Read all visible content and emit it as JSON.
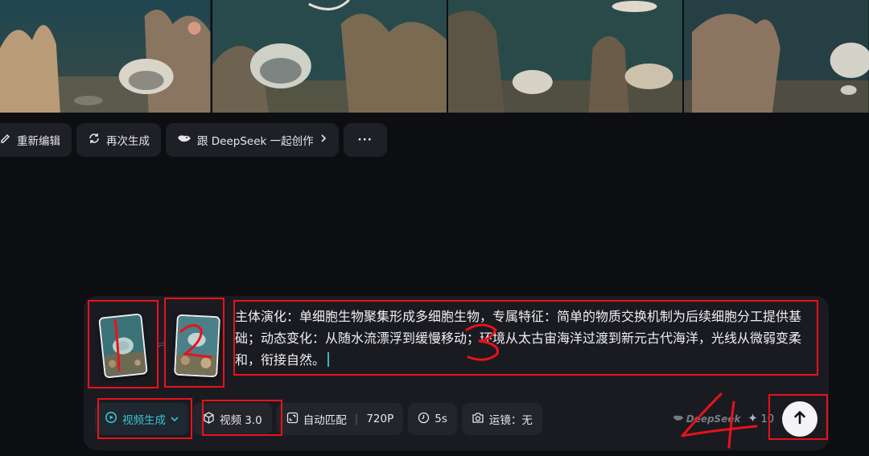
{
  "gallery": {
    "frames": [
      "underwater-coral-shell-frame-1",
      "underwater-coral-shell-frame-2",
      "underwater-coral-shell-frame-3",
      "underwater-coral-shell-frame-4"
    ]
  },
  "actions": {
    "reedit_label": "重新编辑",
    "regenerate_label": "再次生成",
    "deepseek_label": "跟 DeepSeek 一起创作",
    "more_label": "···"
  },
  "composer": {
    "prompt_text": "主体演化：单细胞生物聚集形成多细胞生物，专属特征：简单的物质交换机制为后续细胞分工提供基础；动态变化：从随水流漂浮到缓慢移动；环境从太古宙海洋过渡到新元古代海洋，光线从微弱变柔和，衔接自然。",
    "link_separator": "⇌",
    "mode_label": "视频生成",
    "model_label": "视频 3.0",
    "ratio_label": "自动匹配",
    "resolution_label": "720P",
    "duration_label": "5s",
    "camera_label": "运镜：无",
    "brand_label": "DeepSeek",
    "credits_value": "10"
  },
  "annotations": {
    "labels": [
      "1",
      "2",
      "3",
      "4"
    ],
    "color": "#e8121b"
  },
  "colors": {
    "background": "#0d0e12",
    "accent": "#3fc2d0",
    "annotation": "#e8121b"
  }
}
